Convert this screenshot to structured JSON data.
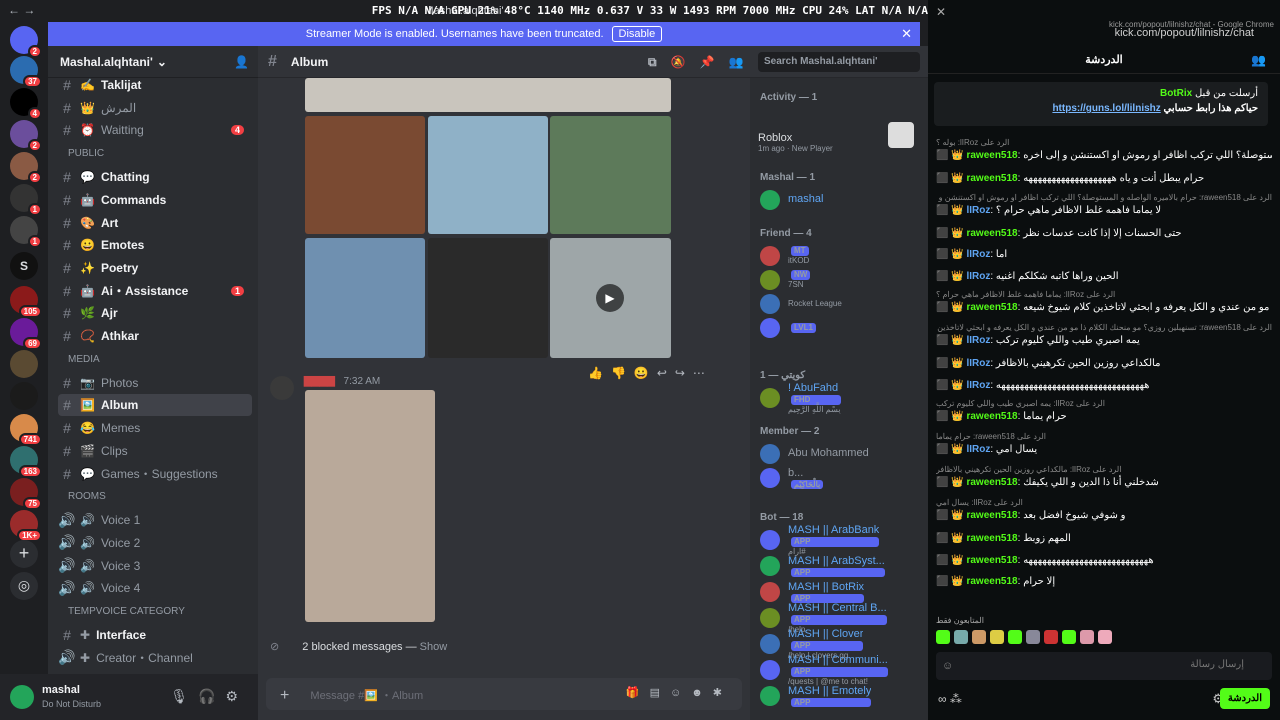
{
  "window": {
    "title": "Mashal.alqhtani'",
    "hud": "FPS N/A N/A  GPU 21% 48°C 1140 MHz 0.637 V 33 W 1493 RPM 7000 MHz  CPU 24%  LAT N/A N/A"
  },
  "banner": {
    "text": "Streamer Mode is enabled. Usernames have been truncated.",
    "button": "Disable"
  },
  "server_badges": [
    "2",
    "37",
    "4",
    "2",
    "2",
    "1",
    "1",
    "105",
    "69",
    "741",
    "163",
    "75",
    "1K+"
  ],
  "guild": {
    "name": "Mashal.alqhtani'"
  },
  "channels": [
    {
      "label": "Taklijat",
      "emoji": "✍️",
      "unread": true
    },
    {
      "label": "المرش",
      "emoji": "👑",
      "unread": false
    },
    {
      "label": "Waitting",
      "emoji": "⏰",
      "unread": false,
      "badge": "4"
    },
    {
      "label": "Public",
      "category": true
    },
    {
      "label": "Chatting",
      "emoji": "💬",
      "unread": true
    },
    {
      "label": "Commands",
      "emoji": "🤖",
      "unread": true
    },
    {
      "label": "Art",
      "emoji": "🎨",
      "unread": true
    },
    {
      "label": "Emotes",
      "emoji": "😀",
      "unread": true
    },
    {
      "label": "Poetry",
      "emoji": "✨",
      "unread": true
    },
    {
      "label": "Ai・Assistance",
      "emoji": "🤖",
      "unread": true,
      "badge": "1"
    },
    {
      "label": "Ajr",
      "emoji": "🌿",
      "unread": true
    },
    {
      "label": "Athkar",
      "emoji": "📿",
      "unread": true
    },
    {
      "label": "Media",
      "category": true
    },
    {
      "label": "Photos",
      "emoji": "📷",
      "unread": false
    },
    {
      "label": "Album",
      "emoji": "🖼️",
      "unread": true,
      "selected": true
    },
    {
      "label": "Memes",
      "emoji": "😂",
      "unread": false
    },
    {
      "label": "Clips",
      "emoji": "🎬",
      "unread": false
    },
    {
      "label": "Games・Suggestions",
      "emoji": "💬",
      "unread": false
    },
    {
      "label": "Rooms",
      "category": true
    },
    {
      "label": "Voice 1",
      "emoji": "🔊",
      "voice": true
    },
    {
      "label": "Voice 2",
      "emoji": "🔊",
      "voice": true
    },
    {
      "label": "Voice 3",
      "emoji": "🔊",
      "voice": true
    },
    {
      "label": "Voice 4",
      "emoji": "🔊",
      "voice": true
    },
    {
      "label": "TEMPVOICE CATEGORY",
      "category": true
    },
    {
      "label": "Interface",
      "emoji": "✚",
      "unread": true
    },
    {
      "label": "Creator・Channel",
      "emoji": "✚",
      "voice": true
    }
  ],
  "user": {
    "name": "mashal",
    "status": "Do Not Disturb"
  },
  "channel_header": {
    "name": "Album",
    "search_placeholder": "Search Mashal.alqhtani'"
  },
  "message": {
    "time": "7:32 AM"
  },
  "blocked": {
    "text": "2 blocked messages — ",
    "show": "Show"
  },
  "composer": {
    "placeholder": "Message #🖼️ ・Album"
  },
  "members": {
    "activity_header": "Activity — 1",
    "activity": {
      "game": "Roblox",
      "detail": "1m ago · New Player"
    },
    "groups": [
      {
        "title": "Mashal — 1",
        "items": [
          {
            "name": "mashal",
            "sub": ""
          }
        ]
      },
      {
        "title": "Friend — 4",
        "items": [
          {
            "name": "",
            "sub": "itKOD",
            "tag": "MT"
          },
          {
            "name": "",
            "sub": "7SN",
            "tag": "NW"
          },
          {
            "name": "",
            "sub": "Rocket League"
          },
          {
            "name": "",
            "sub": "",
            "tag": "LVL1"
          }
        ]
      },
      {
        "title": "كويتي — 1",
        "items": [
          {
            "name": "! AbuFahd",
            "sub": "بِسْمِ اللَّهِ الرَّحِيمِ",
            "tag": "FHD"
          }
        ]
      },
      {
        "title": "Member — 2",
        "items": [
          {
            "name": "Abu Mohammed",
            "sub": ""
          },
          {
            "name": "b...",
            "sub": "",
            "tag": "بِالْحَاكِيْم"
          }
        ]
      },
      {
        "title": "Bot — 18",
        "items": [
          {
            "name": "MASH || ArabBank",
            "sub": "ارام#",
            "tag": "APP"
          },
          {
            "name": "MASH || ArabSyst...",
            "sub": "",
            "tag": "APP"
          },
          {
            "name": "MASH || BotRix",
            "sub": "",
            "tag": "APP"
          },
          {
            "name": "MASH || Central B...",
            "sub": "/help",
            "tag": "APP"
          },
          {
            "name": "MASH || Clover",
            "sub": "/help | clovers.gg",
            "tag": "APP"
          },
          {
            "name": "MASH || Communi...",
            "sub": "/quests | @me to chat!",
            "tag": "APP"
          },
          {
            "name": "MASH || Emotely",
            "sub": "",
            "tag": "APP"
          }
        ]
      }
    ]
  },
  "kick": {
    "window_title": "kick.com/popout/lilnishz/chat - Google Chrome",
    "url": "kick.com/popout/lilnishz/chat",
    "header": "الدردشة",
    "pinned": {
      "by": "أرسلت من قبل",
      "user": "BotRix",
      "text": "حياكم هذا رابط حسابي",
      "link": "https://guns.lol/lilnishz"
    },
    "messages": [
      {
        "reply": "الرد على lIRoz: بوله ؟",
        "user": "raween518",
        "cls": "g",
        "text": "حرام بالاميره الواصله و المستوصلة؟ اللي تركب اظافر او رموش او اكستنشن و إلى اخره"
      },
      {
        "reply": "",
        "user": "raween518",
        "cls": "g",
        "text": "حرام يبطل أنت و ياه هههههههههههههههههههه"
      },
      {
        "reply": "الرد على raween518: حرام بالاميره الواصله و المستوصلة؟ اللي تركب اظافر او رموش او اكستنشن و إلى اخره",
        "user": "lIRoz",
        "cls": "b",
        "text": "لا يماما فاهمه غلط الاظافر ماهي حرام ؟"
      },
      {
        "reply": "",
        "user": "raween518",
        "cls": "g",
        "text": "حتى الحسنات إلا إذا كانت عدسات نظر"
      },
      {
        "reply": "",
        "user": "lIRoz",
        "cls": "b",
        "text": "اما"
      },
      {
        "reply": "",
        "user": "lIRoz",
        "cls": "b",
        "text": "الحين وراها كاتبه شكلكم اغنيه"
      },
      {
        "reply": "الرد على lIRoz: يماما فاهمه غلط الاظافر ماهي حرام ؟",
        "user": "raween518",
        "cls": "g",
        "text": "تسنهبلين روزي؟ مو منحنك الكلام ذا مو من عندي و الكل يعرفه و ابحثي لاتاخذين كلام شيوخ شيعه"
      },
      {
        "reply": "الرد على raween518: تسنهبلين روزي؟ مو منحنك الكلام ذا مو من عندي و الكل يعرفه و ابحثي لاتاخذين كلام شيوخ شيعه",
        "user": "lIRoz",
        "cls": "b",
        "text": "يمه اصبري طيب واللي كليوم تركب"
      },
      {
        "reply": "",
        "user": "lIRoz",
        "cls": "b",
        "text": "مالكداعي روزين الحين تكرهيني بالاظافر"
      },
      {
        "reply": "",
        "user": "lIRoz",
        "cls": "b",
        "text": "ههههههههههههههههههههههههههههههههه"
      },
      {
        "reply": "الرد على lIRoz: يمه اصبري طيب واللي كليوم تركب",
        "user": "raween518",
        "cls": "g",
        "text": "حرام يماما"
      },
      {
        "reply": "الرد على raween518: حرام يماما",
        "user": "lIRoz",
        "cls": "b",
        "text": "يسال امي"
      },
      {
        "reply": "الرد على lIRoz: مالكداعي روزين الحين تكرهيني بالاظافر",
        "user": "raween518",
        "cls": "g",
        "text": "شدخلني أنا ذا الدين و اللي يكيفك"
      },
      {
        "reply": "الرد على lIRoz: يسال امي",
        "user": "raween518",
        "cls": "g",
        "text": "و شوفي شيوخ افضل بعد"
      },
      {
        "reply": "",
        "user": "raween518",
        "cls": "g",
        "text": "المهم زوبط"
      },
      {
        "reply": "",
        "user": "raween518",
        "cls": "g",
        "text": "هههههههههههههههههههههههههههه"
      },
      {
        "reply": "",
        "user": "raween518",
        "cls": "g",
        "text": "إلا حرام"
      }
    ],
    "supporters": "المتابعون فقط",
    "input_placeholder": "إرسال رسالة",
    "chat_button": "الدردشة"
  }
}
